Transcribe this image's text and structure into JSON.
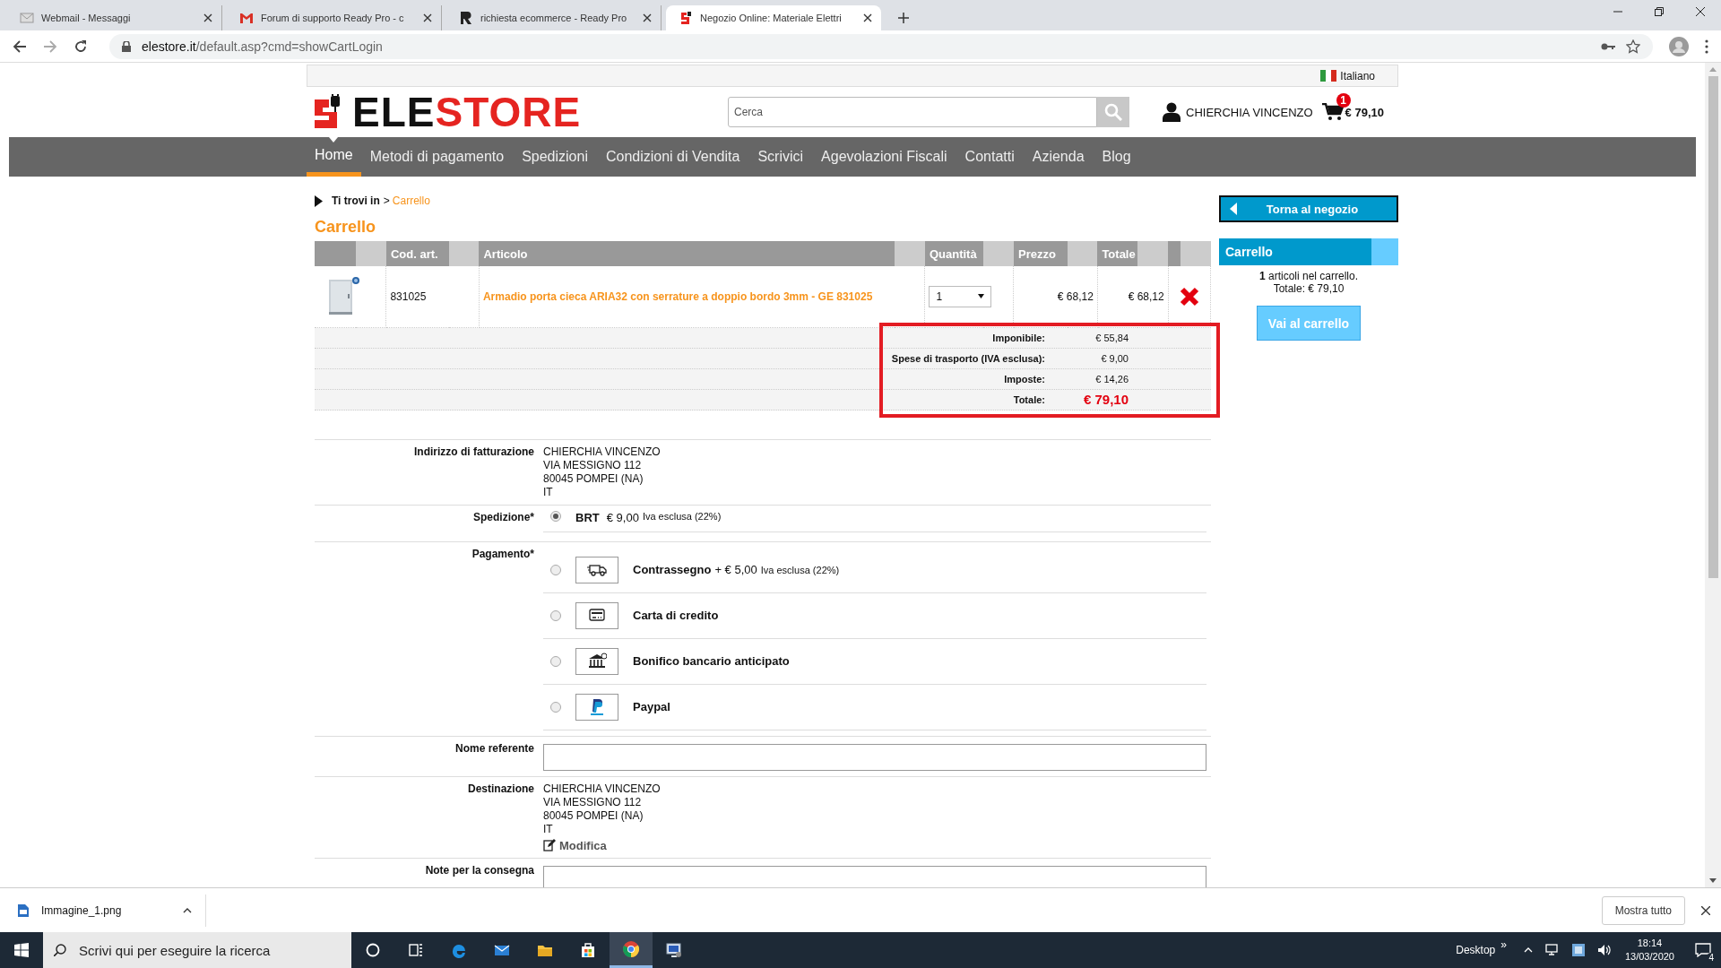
{
  "browser": {
    "tabs": [
      {
        "title": "Webmail - Messaggi",
        "kind": "mail",
        "selected": false
      },
      {
        "title": "Forum di supporto Ready Pro - c",
        "kind": "gmail",
        "selected": false
      },
      {
        "title": "richiesta ecommerce - Ready Pro",
        "kind": "r",
        "selected": false
      },
      {
        "title": "Negozio Online: Materiale Elettri",
        "kind": "store",
        "selected": true
      }
    ],
    "address": {
      "host": "elestore.it",
      "path": "/default.asp?cmd=showCartLogin"
    }
  },
  "site": {
    "language": "Italiano",
    "logo": {
      "dark": "ELE",
      "accent": "STORE"
    },
    "search": {
      "placeholder": "Cerca"
    },
    "user": "CHIERCHIA VINCENZO",
    "cart": {
      "count": "1",
      "total": "€ 79,10"
    },
    "nav": [
      {
        "label": "Home",
        "selected": true
      },
      {
        "label": "Metodi di pagamento",
        "selected": false
      },
      {
        "label": "Spedizioni",
        "selected": false
      },
      {
        "label": "Condizioni di Vendita",
        "selected": false
      },
      {
        "label": "Scrivici",
        "selected": false
      },
      {
        "label": "Agevolazioni Fiscali",
        "selected": false
      },
      {
        "label": "Contatti",
        "selected": false
      },
      {
        "label": "Azienda",
        "selected": false
      },
      {
        "label": "Blog",
        "selected": false
      }
    ]
  },
  "cart": {
    "breadcrumb": {
      "label": "Ti trovi in",
      "separator": ">",
      "current": "Carrello"
    },
    "title": "Carrello",
    "columns": [
      "Cod. art.",
      "Articolo",
      "Quantità",
      "Prezzo",
      "Totale"
    ],
    "rows": [
      {
        "code": "831025",
        "article": "Armadio porta cieca ARIA32 con serrature a doppio bordo 3mm - GE 831025",
        "quantity": "1",
        "price": "€ 68,12",
        "total": "€ 68,12"
      }
    ],
    "summary": [
      {
        "label": "Imponibile:",
        "value": "€ 55,84",
        "kind": "line"
      },
      {
        "label": "Spese di trasporto (IVA esclusa):",
        "value": "€ 9,00",
        "kind": "line"
      },
      {
        "label": "Imposte:",
        "value": "€ 14,26",
        "kind": "line"
      },
      {
        "label": "Totale:",
        "value": "€ 79,10",
        "kind": "grand"
      }
    ]
  },
  "sidebar": {
    "back": "Torna al negozio",
    "title": "Carrello",
    "count": "1",
    "count_text": "articoli nel carrello.",
    "total": "Totale: € 79,10",
    "button": "Vai al carrello"
  },
  "checkout": {
    "billing": {
      "label": "Indirizzo di fatturazione",
      "lines": [
        "CHIERCHIA VINCENZO",
        "VIA MESSIGNO 112",
        "80045 POMPEI (NA)",
        "IT"
      ]
    },
    "shipping": {
      "label": "Spedizione*",
      "options": [
        {
          "name": "BRT",
          "price": "€ 9,00",
          "note": "Iva esclusa (22%)",
          "selected": true
        }
      ]
    },
    "payment": {
      "label": "Pagamento*",
      "options": [
        {
          "kind": "van",
          "name": "Contrassegno",
          "price": "+ € 5,00",
          "note": "Iva esclusa (22%)",
          "selected": false
        },
        {
          "kind": "card",
          "name": "Carta di credito",
          "selected": false
        },
        {
          "kind": "bank",
          "name": "Bonifico bancario anticipato",
          "selected": false
        },
        {
          "kind": "paypal",
          "name": "Paypal",
          "selected": false
        }
      ]
    },
    "referent": {
      "label": "Nome referente"
    },
    "destination": {
      "label": "Destinazione",
      "lines": [
        "CHIERCHIA VINCENZO",
        "VIA MESSIGNO 112",
        "80045 POMPEI (NA)",
        "IT"
      ],
      "edit": "Modifica"
    },
    "notes": {
      "label": "Note per la consegna"
    }
  },
  "download": {
    "file": "Immagine_1.png",
    "show_all": "Mostra tutto"
  },
  "taskbar": {
    "search": {
      "placeholder": "Scrivi qui per eseguire la ricerca"
    },
    "apps": [
      {
        "kind": "cortana",
        "selected": false
      },
      {
        "kind": "taskview",
        "selected": false
      },
      {
        "kind": "edge",
        "selected": false
      },
      {
        "kind": "mail",
        "selected": false
      },
      {
        "kind": "folder",
        "selected": false
      },
      {
        "kind": "store",
        "selected": false
      },
      {
        "kind": "chrome",
        "selected": true
      },
      {
        "kind": "remote",
        "selected": false
      }
    ],
    "desktop": "Desktop",
    "overflow": "»",
    "time": "18:14",
    "date": "13/03/2020",
    "notifications": "4"
  }
}
